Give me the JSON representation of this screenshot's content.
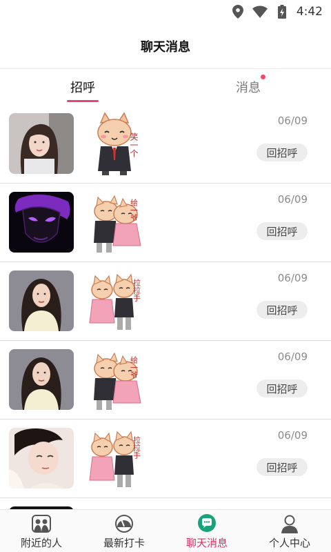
{
  "status_bar": {
    "time": "4:42",
    "icons": [
      "location-icon",
      "wifi-icon",
      "battery-charging-icon"
    ]
  },
  "header": {
    "title": "聊天消息"
  },
  "tabs": [
    {
      "label": "招呼",
      "active": true
    },
    {
      "label": "消息",
      "active": false,
      "has_unread_dot": true
    }
  ],
  "greetings": [
    {
      "date": "06/09",
      "button": "回招呼",
      "sticker_text": "笑一个",
      "avatar": "woman-long-hair-photo"
    },
    {
      "date": "06/09",
      "button": "回招呼",
      "sticker_text": "给一爷",
      "avatar": "purple-mask-art"
    },
    {
      "date": "06/09",
      "button": "回招呼",
      "sticker_text": "拉拉手",
      "avatar": "woman-dark-hair-photo"
    },
    {
      "date": "06/09",
      "button": "回招呼",
      "sticker_text": "给一爷",
      "avatar": "woman-dark-hair-photo"
    },
    {
      "date": "06/09",
      "button": "回招呼",
      "sticker_text": "拉拉手",
      "avatar": "woman-portrait-photo"
    }
  ],
  "bottom_nav": [
    {
      "label": "附近的人",
      "icon": "people-nearby-icon"
    },
    {
      "label": "最新打卡",
      "icon": "checkin-gauge-icon"
    },
    {
      "label": "聊天消息",
      "icon": "chat-bubble-icon",
      "active": true
    },
    {
      "label": "个人中心",
      "icon": "person-icon"
    }
  ],
  "colors": {
    "accent": "#e9437a",
    "active_nav": "#e32d63",
    "chat_icon": "#1aa37a",
    "badge": "#f0486b"
  }
}
